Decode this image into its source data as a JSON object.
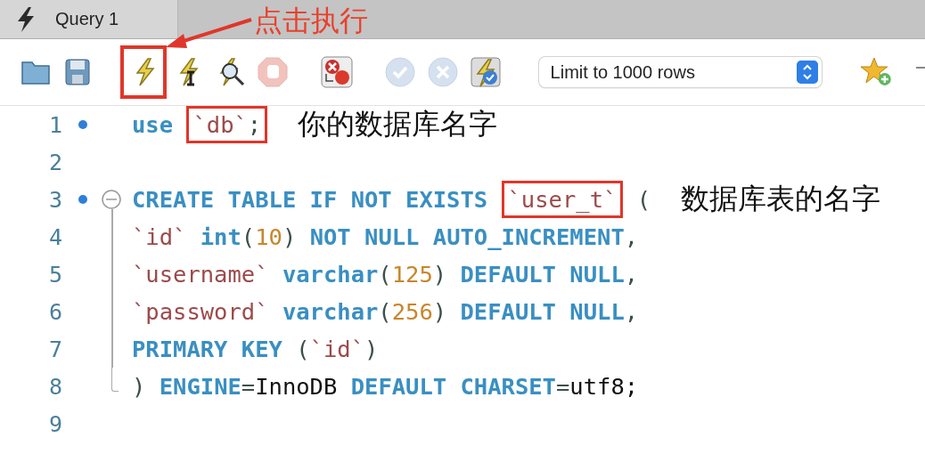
{
  "tab": {
    "label": "Query 1",
    "selected": true
  },
  "toolbar": [
    {
      "kind": "open",
      "disabled": false,
      "highlighted": false,
      "gap_before": false
    },
    {
      "kind": "save",
      "disabled": false,
      "highlighted": false,
      "gap_before": false
    },
    {
      "kind": "run",
      "disabled": false,
      "highlighted": true,
      "gap_before": true
    },
    {
      "kind": "run-current",
      "disabled": false,
      "highlighted": false,
      "gap_before": false
    },
    {
      "kind": "explain",
      "disabled": false,
      "highlighted": false,
      "gap_before": false
    },
    {
      "kind": "stop",
      "disabled": true,
      "highlighted": false,
      "gap_before": false
    },
    {
      "kind": "stop-on-error",
      "disabled": false,
      "highlighted": false,
      "gap_before": true
    },
    {
      "kind": "commit",
      "disabled": true,
      "highlighted": false,
      "gap_before": true
    },
    {
      "kind": "rollback",
      "disabled": true,
      "highlighted": false,
      "gap_before": false
    },
    {
      "kind": "autocommit",
      "disabled": false,
      "highlighted": false,
      "gap_before": false
    }
  ],
  "limit_select": {
    "value": "Limit to 1000 rows"
  },
  "callout": {
    "label": "点击执行"
  },
  "lines": [
    {
      "number": "1",
      "statement": true,
      "tokens": [
        {
          "kind": "kw",
          "text": "use "
        },
        {
          "kind": "ident",
          "text": "`db`",
          "highlighted": true
        },
        {
          "kind": "punct",
          "text": ";",
          "highlighted": true
        }
      ],
      "note": "你的数据库名字"
    },
    {
      "number": "2",
      "statement": false
    },
    {
      "number": "3",
      "statement": true,
      "expanded": true,
      "tokens": [
        {
          "kind": "kw",
          "text": "CREATE TABLE IF NOT EXISTS "
        },
        {
          "kind": "ident",
          "text": "`user_t`",
          "highlighted": true
        },
        {
          "kind": "punct",
          "text": " ("
        }
      ],
      "note": "数据库表的名字",
      "children": [
        {
          "number": "4",
          "statement": false,
          "tokens": [
            {
              "kind": "ident",
              "text": "`id` "
            },
            {
              "kind": "kw",
              "text": "int"
            },
            {
              "kind": "punct",
              "text": "("
            },
            {
              "kind": "num",
              "text": "10"
            },
            {
              "kind": "punct",
              "text": ") "
            },
            {
              "kind": "kw",
              "text": "NOT NULL AUTO_INCREMENT"
            },
            {
              "kind": "punct",
              "text": ","
            }
          ]
        },
        {
          "number": "5",
          "statement": false,
          "tokens": [
            {
              "kind": "ident",
              "text": "`username` "
            },
            {
              "kind": "kw",
              "text": "varchar"
            },
            {
              "kind": "punct",
              "text": "("
            },
            {
              "kind": "num",
              "text": "125"
            },
            {
              "kind": "punct",
              "text": ") "
            },
            {
              "kind": "kw",
              "text": "DEFAULT NULL"
            },
            {
              "kind": "punct",
              "text": ","
            }
          ]
        },
        {
          "number": "6",
          "statement": false,
          "tokens": [
            {
              "kind": "ident",
              "text": "`password` "
            },
            {
              "kind": "kw",
              "text": "varchar"
            },
            {
              "kind": "punct",
              "text": "("
            },
            {
              "kind": "num",
              "text": "256"
            },
            {
              "kind": "punct",
              "text": ") "
            },
            {
              "kind": "kw",
              "text": "DEFAULT NULL"
            },
            {
              "kind": "punct",
              "text": ","
            }
          ]
        },
        {
          "number": "7",
          "statement": false,
          "tokens": [
            {
              "kind": "kw",
              "text": "PRIMARY KEY "
            },
            {
              "kind": "punct",
              "text": "("
            },
            {
              "kind": "ident",
              "text": "`id`"
            },
            {
              "kind": "punct",
              "text": ")"
            }
          ]
        },
        {
          "number": "8",
          "statement": false,
          "tokens": [
            {
              "kind": "punct",
              "text": ") "
            },
            {
              "kind": "kw",
              "text": "ENGINE"
            },
            {
              "kind": "punct",
              "text": "="
            },
            {
              "kind": "plain",
              "text": "InnoDB "
            },
            {
              "kind": "kw",
              "text": "DEFAULT CHARSET"
            },
            {
              "kind": "punct",
              "text": "="
            },
            {
              "kind": "plain",
              "text": "utf8;"
            }
          ]
        }
      ]
    },
    {
      "number": "9",
      "statement": false
    }
  ]
}
